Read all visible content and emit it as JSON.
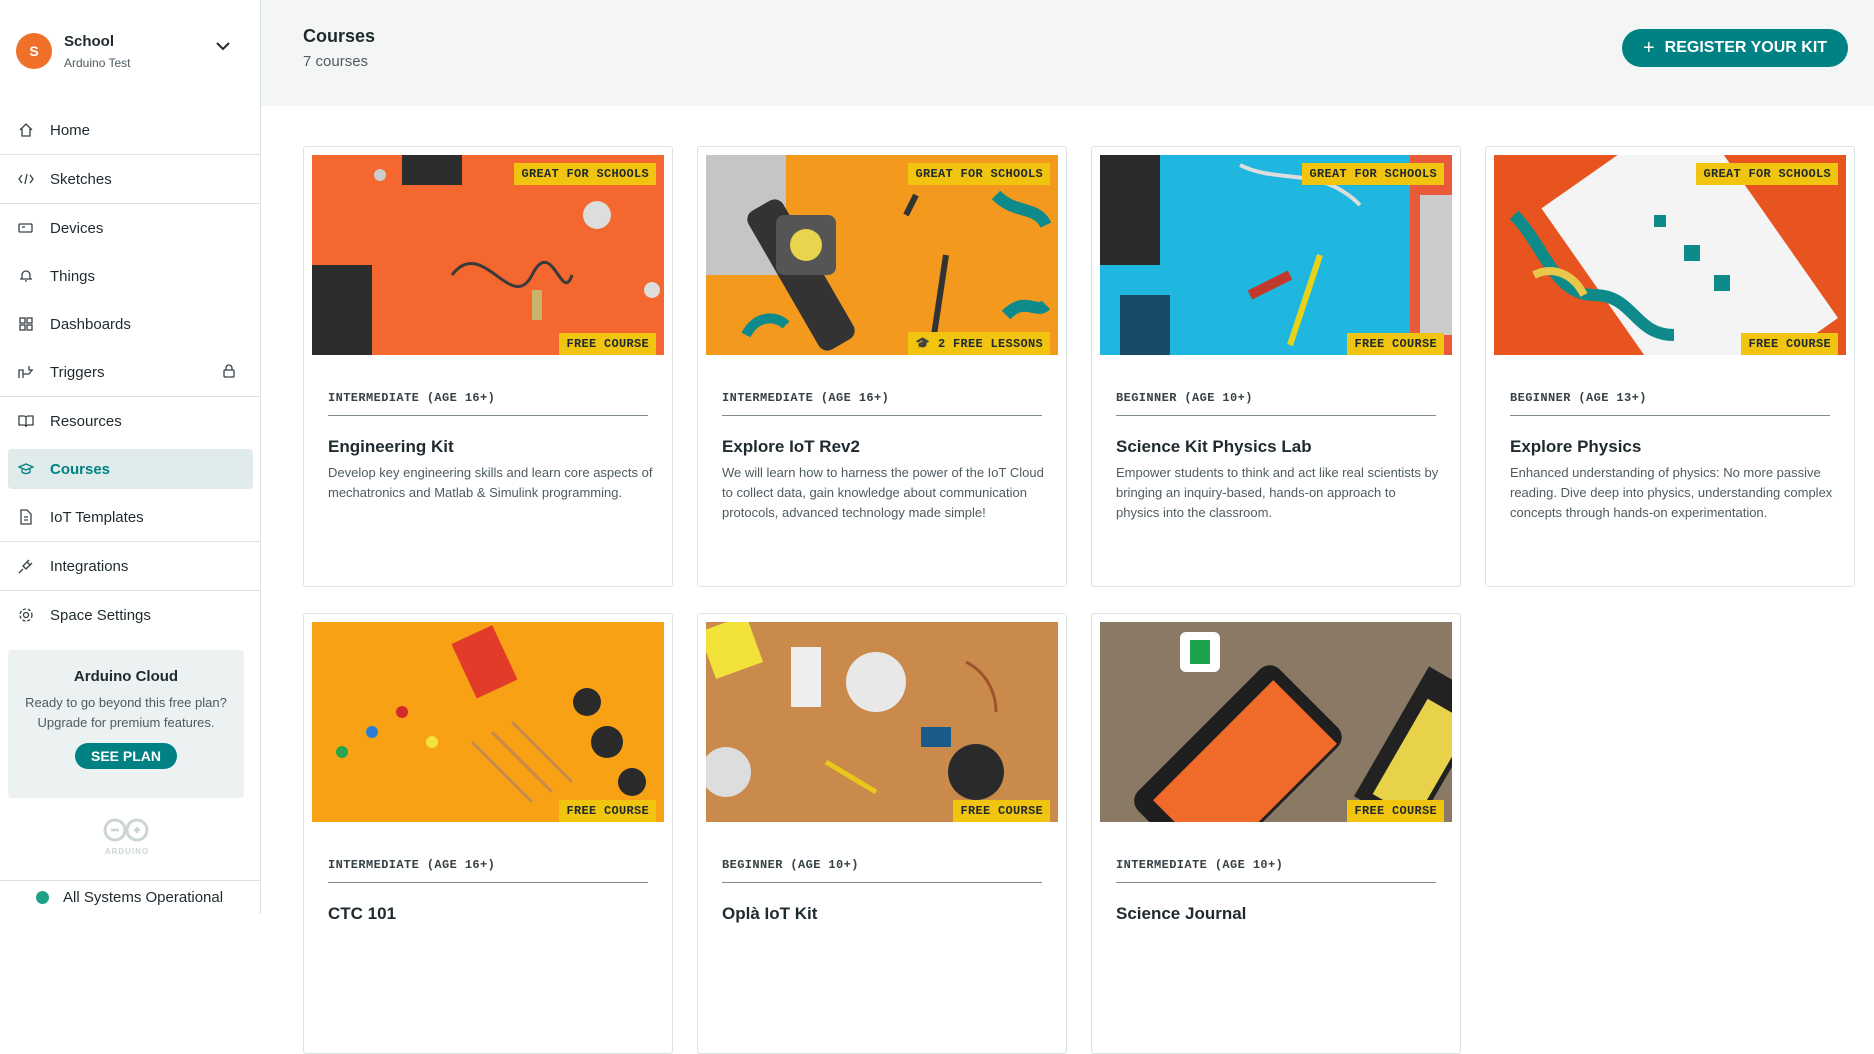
{
  "space": {
    "initial": "S",
    "name": "School",
    "subtitle": "Arduino Test"
  },
  "nav": [
    {
      "label": "Home",
      "icon": "home-icon"
    },
    {
      "label": "Sketches",
      "icon": "code-icon"
    },
    {
      "label": "Devices",
      "icon": "device-icon"
    },
    {
      "label": "Things",
      "icon": "thing-icon"
    },
    {
      "label": "Dashboards",
      "icon": "dashboard-icon"
    },
    {
      "label": "Triggers",
      "icon": "trigger-icon",
      "locked": true
    },
    {
      "label": "Resources",
      "icon": "book-icon"
    },
    {
      "label": "Courses",
      "icon": "graduation-cap-icon",
      "active": true
    },
    {
      "label": "IoT Templates",
      "icon": "templates-icon"
    },
    {
      "label": "Integrations",
      "icon": "plug-icon"
    },
    {
      "label": "Space Settings",
      "icon": "gear-icon"
    }
  ],
  "promo": {
    "title": "Arduino Cloud",
    "line1": "Ready to go beyond this free plan?",
    "line2": "Upgrade for premium features.",
    "button": "SEE PLAN"
  },
  "logo_text": "ARDUINO",
  "status": "All Systems Operational",
  "header": {
    "title": "Courses",
    "count": "7 courses",
    "register_button": "REGISTER YOUR KIT"
  },
  "courses": [
    {
      "badge_top": "GREAT FOR SCHOOLS",
      "badge_bottom": "FREE COURSE",
      "level": "INTERMEDIATE (AGE 16+)",
      "title": "Engineering Kit",
      "description": "Develop key engineering skills and learn core aspects of mechatronics and Matlab & Simulink programming.",
      "bg": "#f4672e"
    },
    {
      "badge_top": "GREAT FOR SCHOOLS",
      "badge_bottom": "2 FREE LESSONS",
      "level": "INTERMEDIATE (AGE 16+)",
      "title": "Explore IoT Rev2",
      "description": "We will learn how to harness the power of the IoT Cloud to collect data, gain knowledge about communication protocols, advanced technology made simple!",
      "bg": "#f39a1e"
    },
    {
      "badge_top": "GREAT FOR SCHOOLS",
      "badge_bottom": "FREE COURSE",
      "level": "BEGINNER (AGE 10+)",
      "title": "Science Kit Physics Lab",
      "description": "Empower students to think and act like real scientists by bringing an inquiry-based, hands-on approach to physics into the classroom.",
      "bg": "#1fb7e0"
    },
    {
      "badge_top": "GREAT FOR SCHOOLS",
      "badge_bottom": "FREE COURSE",
      "level": "BEGINNER (AGE 13+)",
      "title": "Explore Physics",
      "description": "Enhanced understanding of physics: No more passive reading. Dive deep into physics, understanding complex concepts through hands-on experimentation.",
      "bg": "#e8541f"
    },
    {
      "badge_top": "",
      "badge_bottom": "FREE COURSE",
      "level": "INTERMEDIATE (AGE 16+)",
      "title": "CTC 101",
      "description": "",
      "bg": "#f9a114"
    },
    {
      "badge_top": "",
      "badge_bottom": "FREE COURSE",
      "level": "BEGINNER (AGE 10+)",
      "title": "Oplà IoT Kit",
      "description": "",
      "bg": "#c98a4b"
    },
    {
      "badge_top": "",
      "badge_bottom": "FREE COURSE",
      "level": "INTERMEDIATE (AGE 10+)",
      "title": "Science Journal",
      "description": "",
      "bg": "#8a7a65"
    }
  ]
}
